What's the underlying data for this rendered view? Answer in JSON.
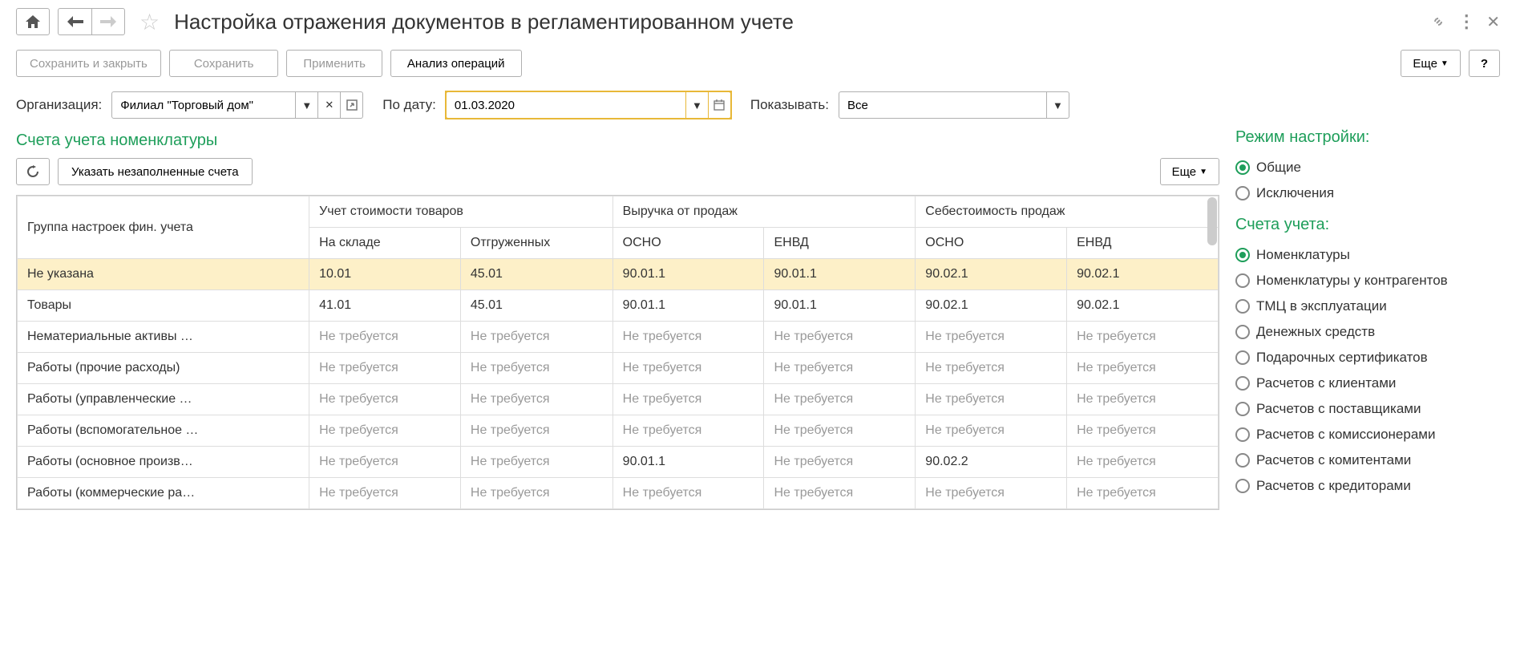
{
  "header": {
    "title": "Настройка отражения документов в регламентированном учете"
  },
  "toolbar": {
    "save_close": "Сохранить и закрыть",
    "save": "Сохранить",
    "apply": "Применить",
    "analyze": "Анализ операций",
    "more": "Еще",
    "help": "?"
  },
  "filters": {
    "org_label": "Организация:",
    "org_value": "Филиал \"Торговый дом\"",
    "date_label": "По дату:",
    "date_value": "01.03.2020",
    "show_label": "Показывать:",
    "show_value": "Все"
  },
  "section": {
    "title": "Счета учета номенклатуры",
    "fill_btn": "Указать незаполненные счета",
    "more": "Еще"
  },
  "table": {
    "headers": {
      "group": "Группа настроек фин. учета",
      "cost": "Учет стоимости товаров",
      "revenue": "Выручка от продаж",
      "cogs": "Себестоимость продаж",
      "stock": "На складе",
      "shipped": "Отгруженных",
      "osno": "ОСНО",
      "envd": "ЕНВД"
    },
    "rows": [
      {
        "group": "Не указана",
        "stock": "10.01",
        "shipped": "45.01",
        "rev_osno": "90.01.1",
        "rev_envd": "90.01.1",
        "cogs_osno": "90.02.1",
        "cogs_envd": "90.02.1",
        "selected": true
      },
      {
        "group": "Товары",
        "stock": "41.01",
        "shipped": "45.01",
        "rev_osno": "90.01.1",
        "rev_envd": "90.01.1",
        "cogs_osno": "90.02.1",
        "cogs_envd": "90.02.1"
      },
      {
        "group": "Нематериальные активы …",
        "stock": "Не требуется",
        "shipped": "Не требуется",
        "rev_osno": "Не требуется",
        "rev_envd": "Не требуется",
        "cogs_osno": "Не требуется",
        "cogs_envd": "Не требуется",
        "muted": true
      },
      {
        "group": "Работы (прочие расходы)",
        "stock": "Не требуется",
        "shipped": "Не требуется",
        "rev_osno": "Не требуется",
        "rev_envd": "Не требуется",
        "cogs_osno": "Не требуется",
        "cogs_envd": "Не требуется",
        "muted": true
      },
      {
        "group": "Работы (управленческие …",
        "stock": "Не требуется",
        "shipped": "Не требуется",
        "rev_osno": "Не требуется",
        "rev_envd": "Не требуется",
        "cogs_osno": "Не требуется",
        "cogs_envd": "Не требуется",
        "muted": true
      },
      {
        "group": "Работы (вспомогательное …",
        "stock": "Не требуется",
        "shipped": "Не требуется",
        "rev_osno": "Не требуется",
        "rev_envd": "Не требуется",
        "cogs_osno": "Не требуется",
        "cogs_envd": "Не требуется",
        "muted": true
      },
      {
        "group": "Работы (основное произв…",
        "stock": "Не требуется",
        "shipped": "Не требуется",
        "rev_osno": "90.01.1",
        "rev_envd": "Не требуется",
        "cogs_osno": "90.02.2",
        "cogs_envd": "Не требуется",
        "mixed": true
      },
      {
        "group": "Работы (коммерческие ра…",
        "stock": "Не требуется",
        "shipped": "Не требуется",
        "rev_osno": "Не требуется",
        "rev_envd": "Не требуется",
        "cogs_osno": "Не требуется",
        "cogs_envd": "Не требуется",
        "muted": true
      }
    ]
  },
  "right": {
    "mode_title": "Режим настройки:",
    "mode_options": [
      {
        "label": "Общие",
        "checked": true
      },
      {
        "label": "Исключения",
        "checked": false
      }
    ],
    "accounts_title": "Счета учета:",
    "accounts_options": [
      {
        "label": "Номенклатуры",
        "checked": true
      },
      {
        "label": "Номенклатуры у контрагентов",
        "checked": false
      },
      {
        "label": "ТМЦ в эксплуатации",
        "checked": false
      },
      {
        "label": "Денежных средств",
        "checked": false
      },
      {
        "label": "Подарочных сертификатов",
        "checked": false
      },
      {
        "label": "Расчетов с клиентами",
        "checked": false
      },
      {
        "label": "Расчетов с поставщиками",
        "checked": false
      },
      {
        "label": "Расчетов с комиссионерами",
        "checked": false
      },
      {
        "label": "Расчетов с комитентами",
        "checked": false
      },
      {
        "label": "Расчетов с кредиторами",
        "checked": false
      }
    ]
  }
}
